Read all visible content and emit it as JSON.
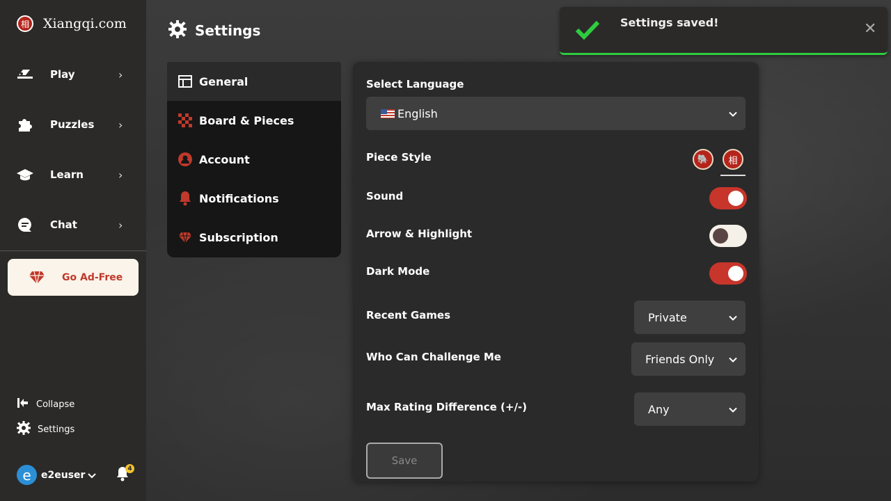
{
  "app": {
    "logo_glyph": "相",
    "name": "Xiangqi.com"
  },
  "sidebar": {
    "items": [
      {
        "label": "Play",
        "icon": "play-board-icon"
      },
      {
        "label": "Puzzles",
        "icon": "puzzle-icon"
      },
      {
        "label": "Learn",
        "icon": "graduation-cap-icon"
      },
      {
        "label": "Chat",
        "icon": "chat-bubble-icon"
      }
    ],
    "adfree_label": "Go Ad-Free",
    "collapse_label": "Collapse",
    "settings_label": "Settings",
    "user": {
      "avatar_letter": "e",
      "name": "e2euser",
      "notification_count": "4"
    }
  },
  "header": {
    "title": "Settings"
  },
  "toast": {
    "message": "Settings saved!",
    "status": "success",
    "accent": "#2ecc40"
  },
  "menu": {
    "items": [
      {
        "label": "General",
        "icon": "layout-icon",
        "active": true
      },
      {
        "label": "Board & Pieces",
        "icon": "checkerboard-icon"
      },
      {
        "label": "Account",
        "icon": "user-circle-icon"
      },
      {
        "label": "Notifications",
        "icon": "bell-icon"
      },
      {
        "label": "Subscription",
        "icon": "diamond-icon"
      }
    ]
  },
  "settings": {
    "language": {
      "label": "Select Language",
      "value": "English"
    },
    "piece_style": {
      "label": "Piece Style",
      "options": [
        "🐘",
        "相"
      ],
      "selected": 1
    },
    "sound": {
      "label": "Sound",
      "on": true
    },
    "arrow_highlight": {
      "label": "Arrow & Highlight",
      "on": false
    },
    "dark_mode": {
      "label": "Dark Mode",
      "on": true
    },
    "recent_games": {
      "label": "Recent Games",
      "value": "Private"
    },
    "challenge": {
      "label": "Who Can Challenge Me",
      "value": "Friends Only"
    },
    "max_rating": {
      "label": "Max Rating Difference (+/-)",
      "value": "Any"
    },
    "save_label": "Save"
  },
  "colors": {
    "accent_red": "#c8352b",
    "sidebar_bg": "#2b2a29"
  }
}
